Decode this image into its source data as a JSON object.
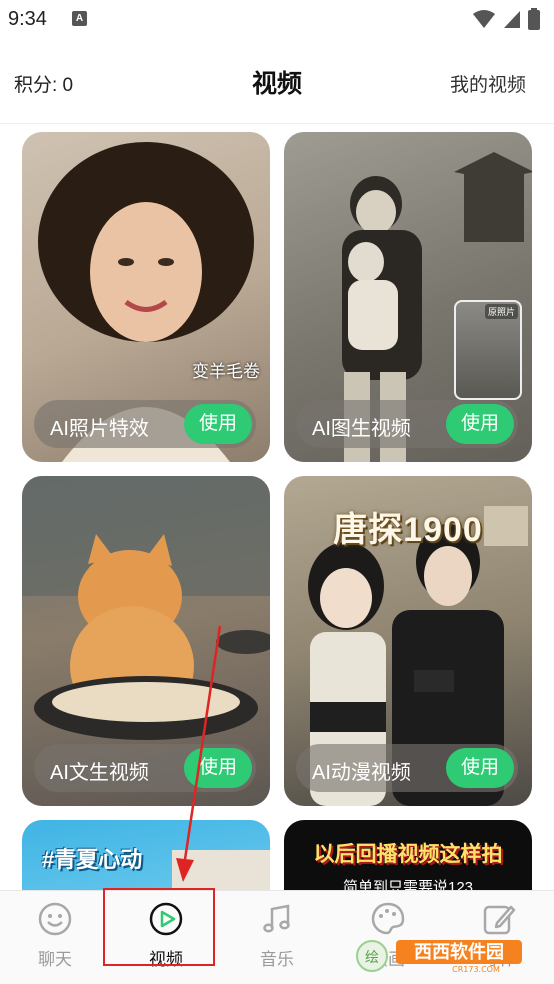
{
  "status_bar": {
    "time": "9:34",
    "notif_glyph": "A"
  },
  "header": {
    "points": "积分: 0",
    "title": "视频",
    "my_videos": "我的视频"
  },
  "cards": [
    {
      "label": "AI照片特效",
      "button": "使用",
      "caption": "变羊毛卷"
    },
    {
      "label": "AI图生视频",
      "button": "使用",
      "thumb_label": "原照片"
    },
    {
      "label": "AI文生视频",
      "button": "使用"
    },
    {
      "label": "AI动漫视频",
      "button": "使用",
      "big_title": "唐探1900"
    },
    {
      "tag_title": "#青夏心动"
    },
    {
      "promo_title": "以后回播视频这样拍",
      "promo_sub": "简单到只需要说123"
    }
  ],
  "bottom_nav": [
    {
      "label": "聊天",
      "icon": "smile-chat-icon"
    },
    {
      "label": "视频",
      "icon": "play-circle-icon",
      "active": true
    },
    {
      "label": "音乐",
      "icon": "music-note-icon"
    },
    {
      "label": "绘画",
      "icon": "palette-icon"
    },
    {
      "label": "写作",
      "icon": "edit-icon"
    }
  ],
  "watermark": {
    "text_cn": "西西软件园",
    "text_en": "CR173.COM"
  },
  "colors": {
    "accent_green": "#2ecb74",
    "annotation_red": "#e02424"
  }
}
